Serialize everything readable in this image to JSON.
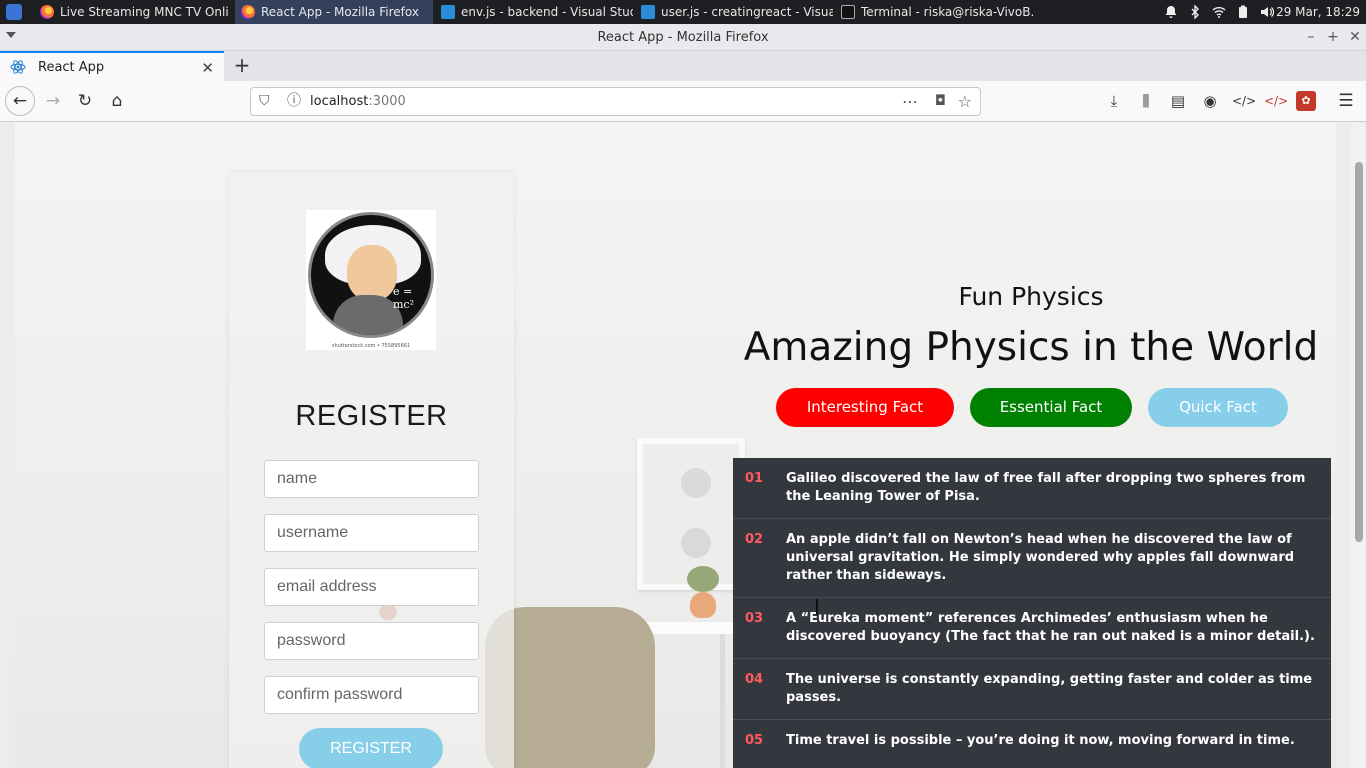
{
  "os": {
    "tasks": [
      {
        "label": "Live Streaming MNC TV Onli...",
        "icon": "firefox-icon"
      },
      {
        "label": "React App - Mozilla Firefox",
        "icon": "firefox-icon"
      },
      {
        "label": "env.js - backend - Visual Stud...",
        "icon": "vscode-icon"
      },
      {
        "label": "user.js - creatingreact - Visua...",
        "icon": "vscode-icon"
      },
      {
        "label": "Terminal - riska@riska-VivoB...",
        "icon": "terminal-icon"
      }
    ],
    "clock": "29 Mar, 18:29"
  },
  "browser": {
    "window_title": "React App - Mozilla Firefox",
    "tab_title": "React App",
    "url_host": "localhost",
    "url_port": ":3000"
  },
  "register": {
    "logo_caption": "shutterstock.com • 755895661",
    "logo_equation": "e = mc²",
    "title": "REGISTER",
    "fields": {
      "name": "name",
      "username": "username",
      "email": "email address",
      "password": "password",
      "confirm": "confirm password"
    },
    "button": "REGISTER"
  },
  "hero": {
    "subtitle": "Fun Physics",
    "title": "Amazing Physics in the World",
    "buttons": {
      "interesting": "Interesting Fact",
      "essential": "Essential Fact",
      "quick": "Quick Fact"
    }
  },
  "facts": [
    {
      "num": "01",
      "text": "Galileo discovered the law of free fall after dropping two spheres from the Leaning Tower of Pisa."
    },
    {
      "num": "02",
      "text": "An apple didn’t fall on Newton’s head when he discovered the law of universal gravitation. He simply wondered why apples fall downward rather than sideways."
    },
    {
      "num": "03",
      "text": "A “Eureka moment” references Archimedes’ enthusiasm when he discovered buoyancy (The fact that he ran out naked is a minor detail.)."
    },
    {
      "num": "04",
      "text": "The universe is constantly expanding, getting faster and colder as time passes."
    },
    {
      "num": "05",
      "text": "Time travel is possible – you’re doing it now, moving forward in time."
    }
  ],
  "colors": {
    "interesting": "#ff0000",
    "essential": "#008000",
    "quick": "#87ceeb",
    "fact_num": "#ff5a5f",
    "facts_bg": "#34373e"
  }
}
